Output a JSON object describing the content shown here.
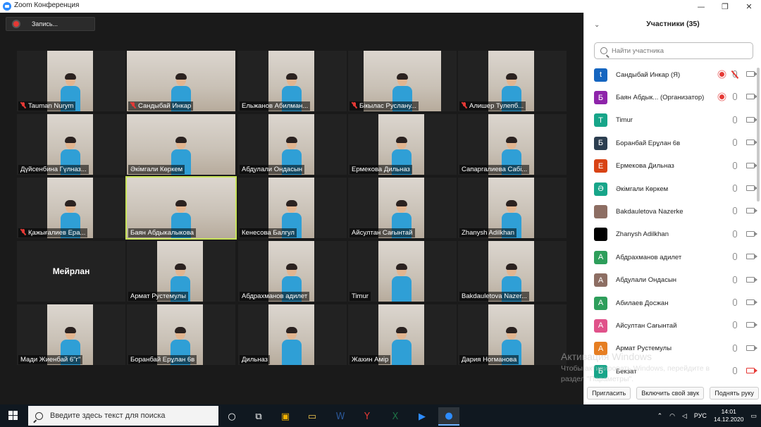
{
  "window": {
    "title": "Zoom Конференция",
    "min": "—",
    "max": "❐",
    "close": "✕"
  },
  "recording": {
    "label": "Запись..."
  },
  "tiles": [
    {
      "name": "Tauman Nurym",
      "muted": true,
      "frame": "narrow"
    },
    {
      "name": "Сандыбай Инкар",
      "muted": true,
      "frame": "wide"
    },
    {
      "name": "Ельжанов Абилман...",
      "muted": false,
      "frame": "narrow"
    },
    {
      "name": "Бікылас Руслану...",
      "muted": true,
      "frame": "mid"
    },
    {
      "name": "Алишер Тулепб...",
      "muted": true,
      "frame": "narrow"
    },
    {
      "name": "Дүйсенбина Гүлназ...",
      "muted": false,
      "frame": "narrow"
    },
    {
      "name": "Әкімгали Көркем",
      "muted": false,
      "frame": "wide"
    },
    {
      "name": "Абдулали Ондасын",
      "muted": false,
      "frame": "narrow"
    },
    {
      "name": "Ермекова Дильназ",
      "muted": false,
      "frame": "narrow"
    },
    {
      "name": "Сапаргалиева Сабі...",
      "muted": false,
      "frame": "narrow"
    },
    {
      "name": "Қажығалиев Ера...",
      "muted": true,
      "frame": "narrow"
    },
    {
      "name": "Баян Абдыкалыкова",
      "muted": false,
      "frame": "wide",
      "active": true
    },
    {
      "name": "Кенесова Балгул",
      "muted": false,
      "frame": "narrow"
    },
    {
      "name": "Айсултан Сағынтай",
      "muted": false,
      "frame": "narrow"
    },
    {
      "name": "Zhanysh Adilkhan",
      "muted": false,
      "frame": "narrow"
    },
    {
      "name": "Мейрлан",
      "muted": false,
      "frame": "none"
    },
    {
      "name": "Армат Рустемулы",
      "muted": false,
      "frame": "narrow"
    },
    {
      "name": "Абдрахманов адилет",
      "muted": false,
      "frame": "narrow"
    },
    {
      "name": "Timur",
      "muted": false,
      "frame": "narrow"
    },
    {
      "name": "Bakdauletova Nazer...",
      "muted": false,
      "frame": "narrow"
    },
    {
      "name": "Мади Жиенбай 6\"г\"",
      "muted": false,
      "frame": "narrow"
    },
    {
      "name": "Боранбай Ерұлан 6в",
      "muted": false,
      "frame": "narrow"
    },
    {
      "name": "Дильназ",
      "muted": false,
      "frame": "narrow"
    },
    {
      "name": "Жахин Амір",
      "muted": false,
      "frame": "narrow"
    },
    {
      "name": "Дария Ногманова",
      "muted": false,
      "frame": "narrow"
    }
  ],
  "participants_panel": {
    "title": "Участники (35)",
    "search_placeholder": "Найти участника",
    "items": [
      {
        "avatar": "t",
        "color": "#1565c0",
        "name": "Сандыбай Инкар (Я)",
        "rec": true,
        "mic_off": true,
        "cam_off": false
      },
      {
        "avatar": "Б",
        "color": "#8e24aa",
        "name": "Баян Абдык... (Организатор)",
        "rec": true,
        "mic_off": false,
        "cam_off": false
      },
      {
        "avatar": "T",
        "color": "#17a589",
        "name": "Timur",
        "rec": false,
        "mic_off": false,
        "cam_off": false
      },
      {
        "avatar": "Б",
        "color": "#2c3e50",
        "name": "Боранбай Ерұлан 6в",
        "rec": false,
        "mic_off": false,
        "cam_off": false
      },
      {
        "avatar": "Е",
        "color": "#d84315",
        "name": "Ермекова Дильназ",
        "rec": false,
        "mic_off": false,
        "cam_off": false
      },
      {
        "avatar": "Ә",
        "color": "#17a589",
        "name": "Әкімгали Көркем",
        "rec": false,
        "mic_off": false,
        "cam_off": false
      },
      {
        "avatar": "",
        "color": "#8d6e63",
        "name": "Bakdauletova Nazerke",
        "rec": false,
        "mic_off": false,
        "cam_off": false
      },
      {
        "avatar": "",
        "color": "#000000",
        "name": "Zhanysh Adilkhan",
        "rec": false,
        "mic_off": false,
        "cam_off": false
      },
      {
        "avatar": "А",
        "color": "#2e9e5b",
        "name": "Абдрахманов адилет",
        "rec": false,
        "mic_off": false,
        "cam_off": false
      },
      {
        "avatar": "А",
        "color": "#8d6e63",
        "name": "Абдулали Ондасын",
        "rec": false,
        "mic_off": false,
        "cam_off": false
      },
      {
        "avatar": "А",
        "color": "#2e9e5b",
        "name": "Абилаев Досжан",
        "rec": false,
        "mic_off": false,
        "cam_off": false
      },
      {
        "avatar": "А",
        "color": "#e0528a",
        "name": "Айсултан Сағынтай",
        "rec": false,
        "mic_off": false,
        "cam_off": false
      },
      {
        "avatar": "А",
        "color": "#e67e22",
        "name": "Армат Рустемулы",
        "rec": false,
        "mic_off": false,
        "cam_off": false
      },
      {
        "avatar": "Б",
        "color": "#17a589",
        "name": "Бекзат",
        "rec": false,
        "mic_off": false,
        "cam_off": true
      }
    ],
    "footer": {
      "invite": "Пригласить",
      "unmute": "Включить свой звук",
      "raise_hand": "Поднять руку"
    }
  },
  "watermark": {
    "line1": "Активация Windows",
    "line2": "Чтобы активировать Windows, перейдите в",
    "line3": "раздел \"Параметры\"."
  },
  "taskbar": {
    "search_placeholder": "Введите здесь текст для поиска",
    "apps": [
      "cortana-icon",
      "task-view-icon",
      "store-icon",
      "explorer-icon",
      "word-icon",
      "yandex-icon",
      "excel-icon",
      "media-icon",
      "zoom-icon"
    ],
    "language": "РУС",
    "time": "14:01",
    "date": "14.12.2020"
  }
}
